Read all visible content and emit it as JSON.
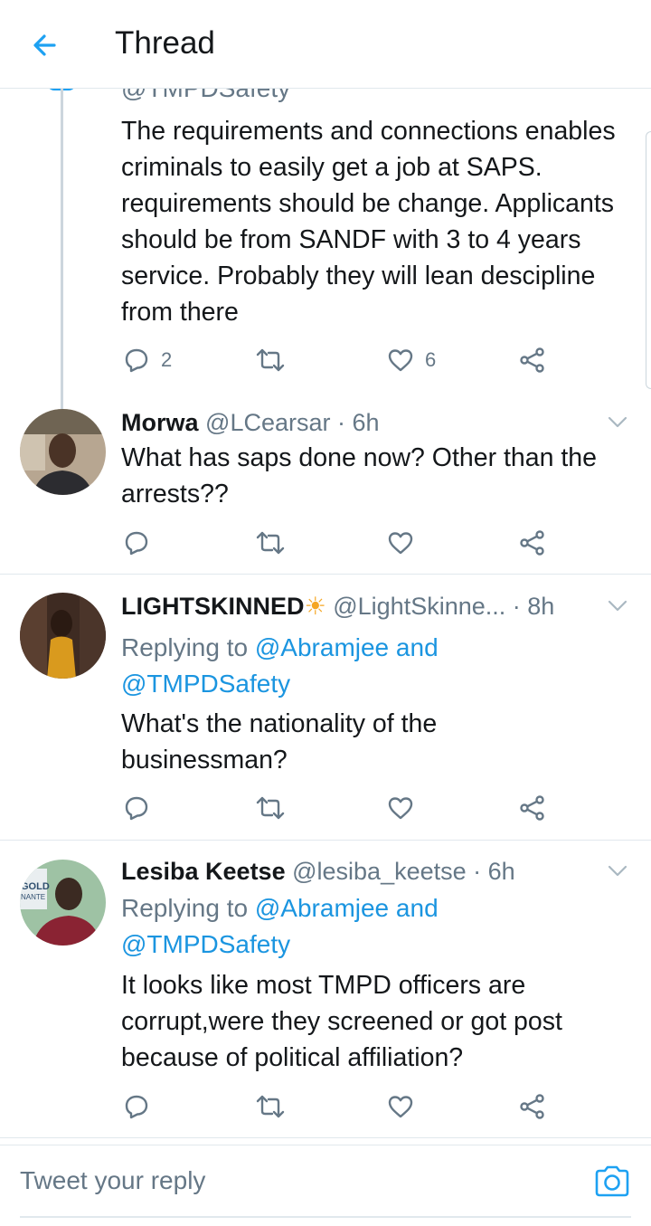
{
  "header": {
    "title": "Thread"
  },
  "top_tweet": {
    "handle_partial": "@TMPDSafety",
    "text": "The requirements and connections enables criminals to easily get a job at SAPS. requirements should be change. Applicants should be from SANDF with 3 to 4 years service. Probably they will lean descipline from there",
    "replies": "2",
    "likes": "6"
  },
  "tweets": [
    {
      "name": "Morwa",
      "handle": "@LCearsar",
      "time": "· 6h",
      "text": "What has saps done now? Other than the arrests??"
    },
    {
      "name": "LIGHTSKINNED",
      "emoji": "☀",
      "handle": "@LightSkinne...",
      "time": "· 8h",
      "reply_prefix": "Replying to ",
      "reply_user1": "@Abramjee",
      "reply_and": " and",
      "reply_user2": "@TMPDSafety",
      "text": "What's the nationality of the businessman?"
    },
    {
      "name": "Lesiba Keetse",
      "handle": "@lesiba_keetse",
      "time": "· 6h",
      "reply_prefix": "Replying to ",
      "reply_user1": "@Abramjee",
      "reply_and": " and",
      "reply_user2": "@TMPDSafety",
      "text": "It looks like most TMPD officers are corrupt,were they screened or got post because of political affiliation?",
      "avatar_text": "GOLD\nNANTE"
    }
  ],
  "compose": {
    "placeholder": "Tweet your reply"
  },
  "colors": {
    "accent": "#1da1f2",
    "link": "#1b95e0",
    "muted": "#657786"
  }
}
